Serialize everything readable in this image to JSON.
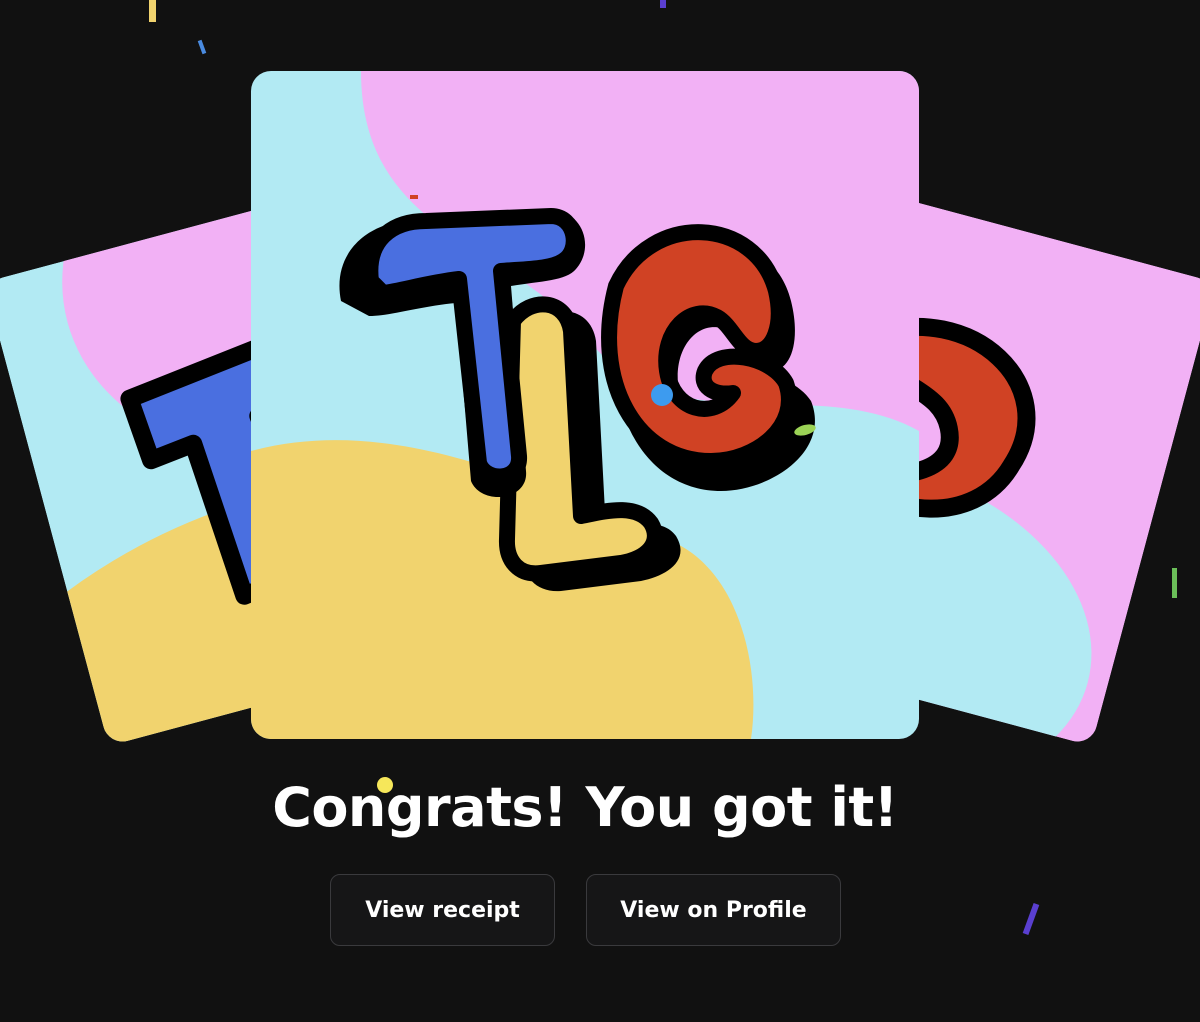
{
  "headline": "Congrats! You got it!",
  "actions": {
    "receipt_label": "View receipt",
    "profile_label": "View on Profile"
  },
  "artwork": {
    "lettering": "TLG",
    "colors": {
      "background": "#111111",
      "pink": "#F2B1F5",
      "cyan": "#B2EAF3",
      "yellow": "#F1D36E",
      "blue": "#4A6FE0",
      "red": "#D04224",
      "outline": "#000000"
    }
  }
}
